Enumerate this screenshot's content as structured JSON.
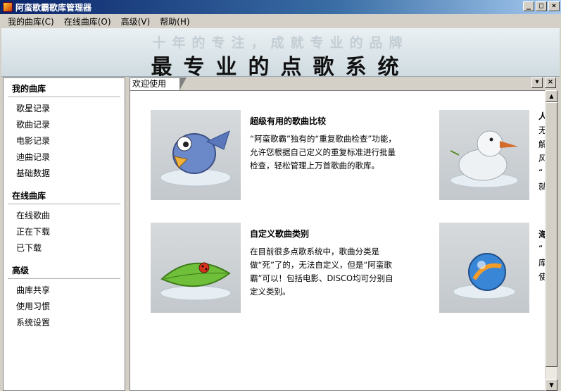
{
  "window": {
    "title": "阿蛮歌霸歌库管理器",
    "controls": {
      "minimize": "_",
      "maximize": "□",
      "close": "×"
    }
  },
  "menubar": {
    "items": [
      {
        "label": "我的曲库(C)"
      },
      {
        "label": "在线曲库(O)"
      },
      {
        "label": "高级(V)"
      },
      {
        "label": "帮助(H)"
      }
    ]
  },
  "banner": {
    "slogan": "十年的专注，成就专业的品牌",
    "headline": "最专业的点歌系统"
  },
  "sidebar": {
    "sections": [
      {
        "title": "我的曲库",
        "items": [
          "歌星记录",
          "歌曲记录",
          "电影记录",
          "迪曲记录",
          "基础数据"
        ]
      },
      {
        "title": "在线曲库",
        "items": [
          "在线歌曲",
          "正在下载",
          "已下载"
        ]
      },
      {
        "title": "高级",
        "items": [
          "曲库共享",
          "使用习惯",
          "系统设置"
        ]
      }
    ]
  },
  "tabs": {
    "active": "欢迎使用",
    "dropdown_icon": "▾",
    "close_icon": "×"
  },
  "features": [
    {
      "title": "超级有用的歌曲比较",
      "desc": "“阿蛮歌霸”独有的“重复歌曲检查”功能，允许您根据自己定义的重复标准进行批量检查，轻松管理上万首歌曲的歌库。",
      "icon": "bird-icon"
    },
    {
      "title": "自定义歌曲类别",
      "desc": "在目前很多点歌系统中，歌曲分类是做“死”了的，无法自定义，但是“阿蛮歌霸”可以！包括电影、DISCO均可分别自定义类别。",
      "icon": "leaf-ladybug-icon"
    }
  ],
  "right_column_cut": {
    "col1": [
      "人",
      "无",
      "解",
      "风",
      "“",
      "就"
    ],
    "col2": [
      "海",
      "“",
      "库",
      "使"
    ]
  },
  "scroll": {
    "up": "▲",
    "down": "▼"
  }
}
